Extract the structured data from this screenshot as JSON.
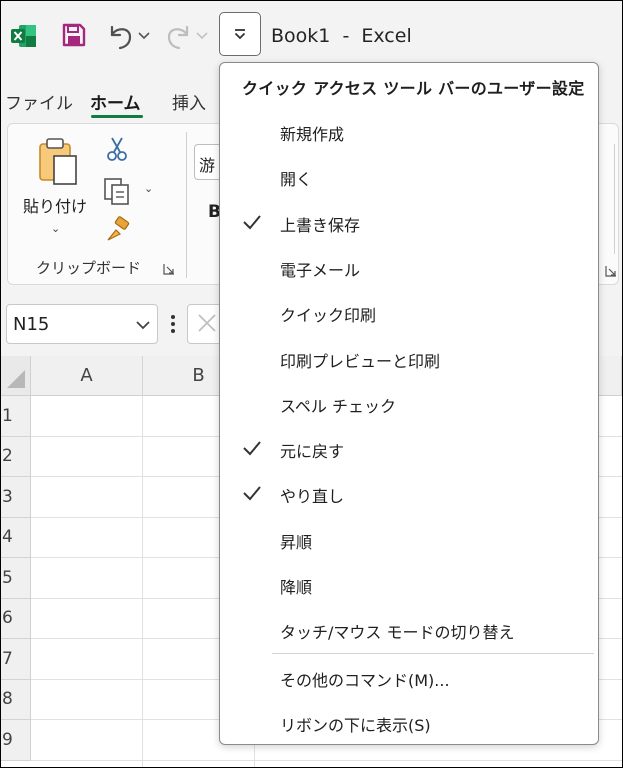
{
  "window": {
    "title": "Book1  -  Excel"
  },
  "ribbon_tabs": [
    {
      "label": "ファイル"
    },
    {
      "label": "ホーム",
      "active": true
    },
    {
      "label": "挿入"
    }
  ],
  "clipboard_group": {
    "paste_label": "貼り付け",
    "group_label": "クリップボード"
  },
  "font": {
    "name": "游",
    "bold_label": "B"
  },
  "name_box": {
    "value": "N15"
  },
  "grid": {
    "columns": [
      "A",
      "B"
    ],
    "rows": [
      "1",
      "2",
      "3",
      "4",
      "5",
      "6",
      "7",
      "8",
      "9"
    ]
  },
  "qat_menu": {
    "title": "クイック アクセス ツール バーのユーザー設定",
    "items": [
      {
        "label": "新規作成",
        "checked": false
      },
      {
        "label": "開く",
        "checked": false
      },
      {
        "label": "上書き保存",
        "checked": true
      },
      {
        "label": "電子メール",
        "checked": false
      },
      {
        "label": "クイック印刷",
        "checked": false
      },
      {
        "label": "印刷プレビューと印刷",
        "checked": false
      },
      {
        "label": "スペル チェック",
        "checked": false
      },
      {
        "label": "元に戻す",
        "checked": true
      },
      {
        "label": "やり直し",
        "checked": true
      },
      {
        "label": "昇順",
        "checked": false
      },
      {
        "label": "降順",
        "checked": false
      },
      {
        "label": "タッチ/マウス モードの切り替え",
        "checked": false
      }
    ],
    "footer_items": [
      {
        "label": "その他のコマンド(M)..."
      },
      {
        "label": "リボンの下に表示(S)"
      }
    ]
  },
  "colors": {
    "excel_green": "#107c41",
    "save_purple": "#a4287d",
    "accent_underline": "#107c41"
  }
}
